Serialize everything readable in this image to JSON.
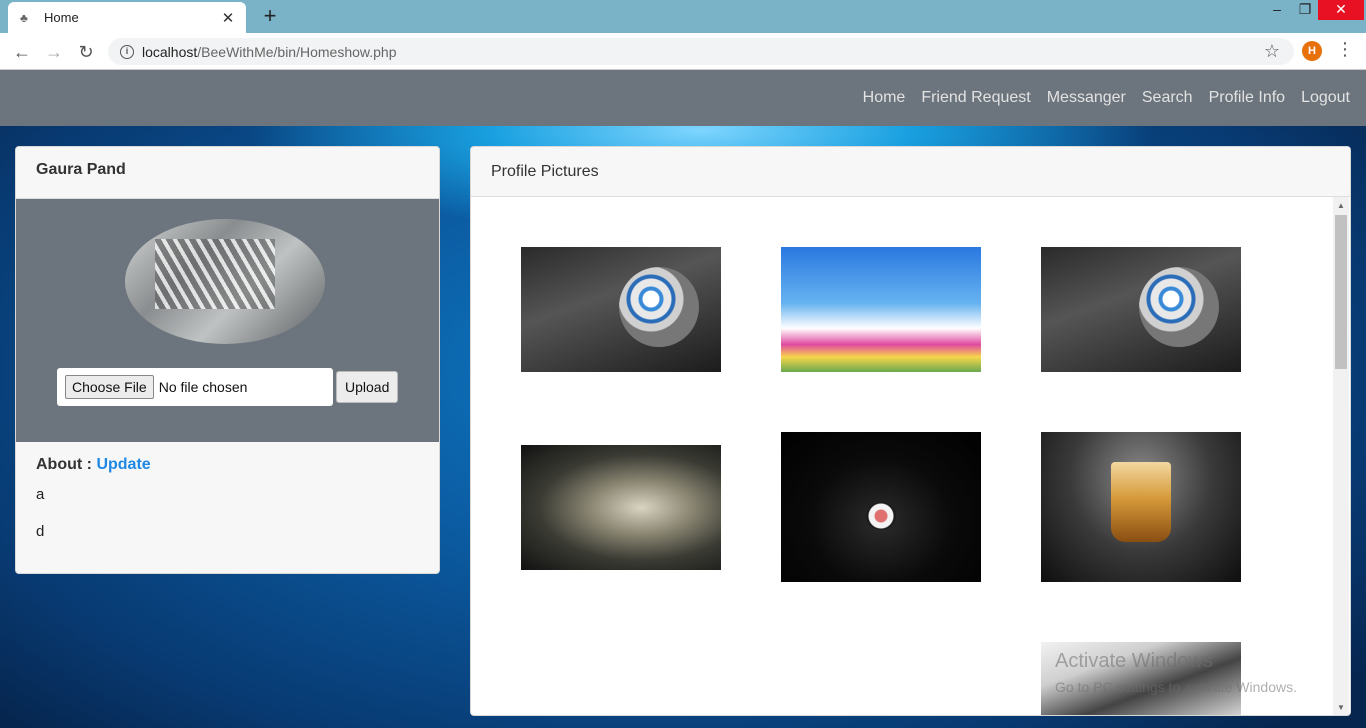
{
  "browser": {
    "tab_title": "Home",
    "url_host": "localhost",
    "url_path": "/BeeWithMe/bin/Homeshow.php",
    "profile_initial": "H"
  },
  "nav": {
    "items": [
      "Home",
      "Friend Request",
      "Messanger",
      "Search",
      "Profile Info",
      "Logout"
    ]
  },
  "profile": {
    "name": "Gaura Pand",
    "choose_file_label": "Choose File",
    "no_file_label": "No file chosen",
    "upload_label": "Upload",
    "about_label": "About :",
    "update_label": "Update",
    "about_lines": [
      "a",
      "d"
    ]
  },
  "gallery": {
    "title": "Profile Pictures",
    "images": [
      "abstract-sphere",
      "flower-field",
      "abstract-sphere",
      "fractal-leopard",
      "black-panther",
      "whiskey-glass",
      "gray-abstract"
    ]
  },
  "watermark": {
    "title": "Activate Windows",
    "subtitle": "Go to PC settings to activate Windows."
  }
}
